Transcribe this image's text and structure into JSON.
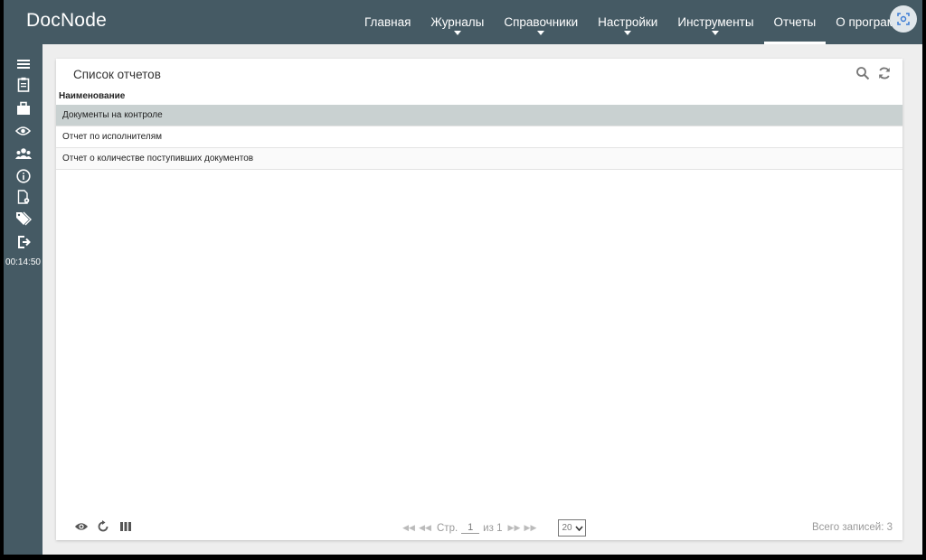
{
  "app": {
    "title": "DocNode"
  },
  "nav": {
    "items": [
      {
        "label": "Главная",
        "dropdown": false,
        "active": false
      },
      {
        "label": "Журналы",
        "dropdown": true,
        "active": false
      },
      {
        "label": "Справочники",
        "dropdown": true,
        "active": false
      },
      {
        "label": "Настройки",
        "dropdown": true,
        "active": false
      },
      {
        "label": "Инструменты",
        "dropdown": true,
        "active": false
      },
      {
        "label": "Отчеты",
        "dropdown": false,
        "active": true
      },
      {
        "label": "О программ",
        "dropdown": false,
        "active": false
      }
    ]
  },
  "sidebar": {
    "icons": [
      "menu-icon",
      "clipboard-icon",
      "briefcase-icon",
      "eye-icon",
      "users-icon",
      "info-icon",
      "document-settings-icon",
      "tags-icon",
      "logout-icon"
    ],
    "clock": "00:14:50"
  },
  "panel": {
    "title": "Список отчетов",
    "column_header": "Наименование",
    "rows": [
      {
        "name": "Документы на контроле",
        "selected": true
      },
      {
        "name": "Отчет по исполнителям",
        "selected": false
      },
      {
        "name": "Отчет о количестве поступивших документов",
        "selected": false
      }
    ]
  },
  "footer": {
    "page_label": "Стр.",
    "page_value": "1",
    "of_label": "из 1",
    "page_size": "20",
    "total": "Всего записей: 3"
  },
  "colors": {
    "topbar": "#455a64",
    "selected_row": "#c9d1d1",
    "background": "#eeeeee"
  }
}
